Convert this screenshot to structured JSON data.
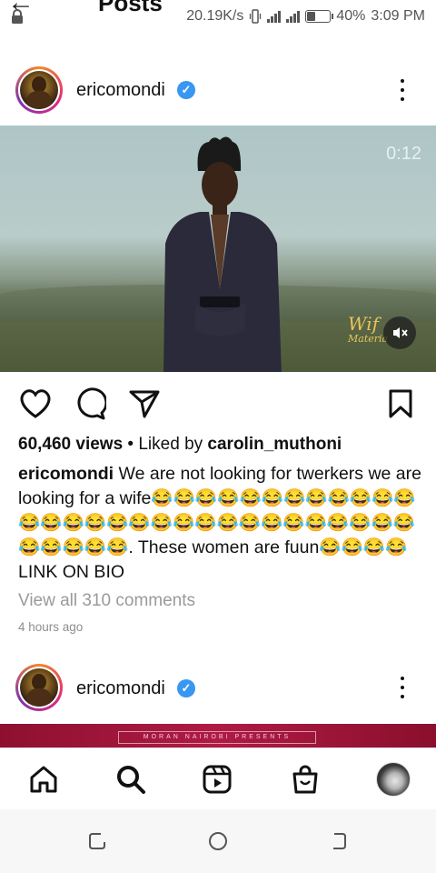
{
  "header": {
    "title": "Posts"
  },
  "status_bar": {
    "speed": "20.19K/s",
    "battery": "40%",
    "battery_level": 0.4,
    "time": "3:09 PM"
  },
  "post1": {
    "username": "ericomondi",
    "video_time": "0:12",
    "watermark_line1": "Wif",
    "watermark_line2": "Materia",
    "views": "60,460 views",
    "liked_by_prefix": " • Liked by ",
    "liked_by_user": "carolin_muthoni",
    "caption_user": "ericomondi",
    "caption_text": " We are not looking for twerkers we are looking for a wife😂😂😂😂😂😂😂😂😂😂😂😂😂😂😂😂😂😂😂😂😂😂😂😂😂😂😂😂😂😂😂😂😂😂😂. These women are fuun😂😂😂😂 LINK ON BIO",
    "view_comments": "View all 310 comments",
    "time_ago": "4 hours ago"
  },
  "post2": {
    "username": "ericomondi",
    "banner_text": "MORAN NAIROBI PRESENTS"
  },
  "icons": {
    "like": "heart-icon",
    "comment": "comment-icon",
    "share": "send-icon",
    "save": "bookmark-icon",
    "home": "home-icon",
    "search": "search-icon",
    "reels": "reels-icon",
    "shop": "shop-icon"
  },
  "colors": {
    "verified": "#3897f0",
    "text": "#111111",
    "muted": "#8e8e8e"
  }
}
